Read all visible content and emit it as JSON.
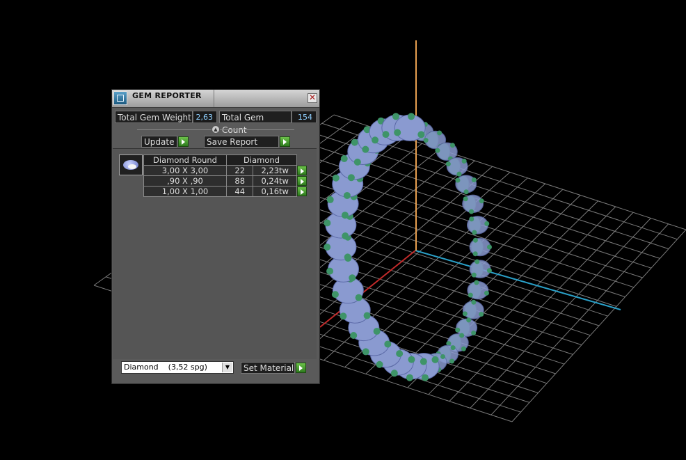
{
  "window": {
    "title": "GEM REPORTER",
    "close_glyph": "✕"
  },
  "summary": {
    "weight_label": "Total Gem Weight",
    "weight_value": "2,63",
    "count_label": "Total Gem Count",
    "count_value": "154"
  },
  "actions": {
    "update_label": "Update",
    "save_label": "Save Report"
  },
  "gem_table": {
    "headers": [
      "Diamond Round",
      "Diamond"
    ],
    "rows": [
      {
        "size": "3,00 X 3,00",
        "count": "22",
        "weight": "2,23tw"
      },
      {
        "size": ",90 X ,90",
        "count": "88",
        "weight": "0,24tw"
      },
      {
        "size": "1,00 X 1,00",
        "count": "44",
        "weight": "0,16tw"
      }
    ]
  },
  "material": {
    "selected": "Diamond    (3,52 spg)",
    "set_label": "Set Material"
  },
  "colors": {
    "background": "#000000",
    "panel": "#5a5a5a",
    "accent_green": "#4caf34",
    "value_text": "#8fd0ff",
    "axis_x": "#c02a2a",
    "axis_y": "#2aa0c8",
    "axis_z": "#e8a050",
    "gem": "#8a9ad0",
    "setting": "#2f7a55"
  },
  "icons": {
    "app": "gem-reporter-icon",
    "close": "close-icon",
    "collapse": "collapse-up-icon",
    "go": "play-arrow-icon",
    "thumb": "diamond-thumbnail-icon"
  }
}
